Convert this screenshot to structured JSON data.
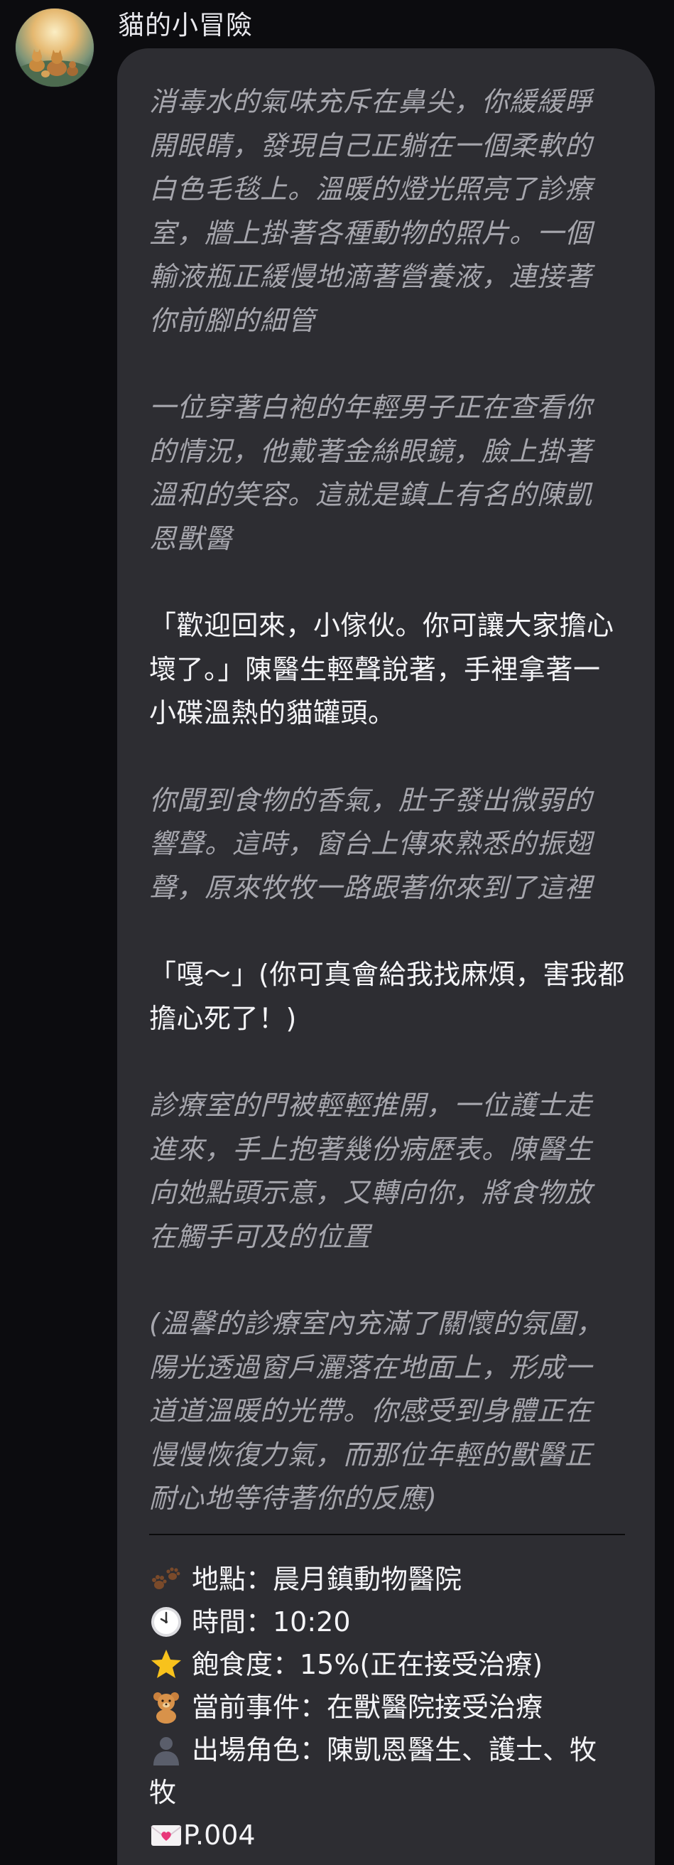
{
  "chat": {
    "sender_name": "貓的小冒險"
  },
  "message": {
    "p1": [
      "消毒水的氣味充斥在鼻尖，你緩緩睜",
      "開眼睛，發現自己正躺在一個柔軟的",
      "白色毛毯上。溫暖的燈光照亮了診療",
      "室，牆上掛著各種動物的照片。一個",
      "輸液瓶正緩慢地滴著營養液，連接著",
      "你前腳的細管"
    ],
    "p2": [
      "一位穿著白袍的年輕男子正在查看你",
      "的情況，他戴著金絲眼鏡，臉上掛著",
      "溫和的笑容。這就是鎮上有名的陳凱",
      "恩獸醫"
    ],
    "p3": [
      "「歡迎回來，小傢伙。你可讓大家擔心",
      "壞了。」陳醫生輕聲說著，手裡拿著一",
      "小碟溫熱的貓罐頭。"
    ],
    "p4": [
      "你聞到食物的香氣，肚子發出微弱的",
      "響聲。這時，窗台上傳來熟悉的振翅",
      "聲，原來牧牧一路跟著你來到了這裡"
    ],
    "p5": [
      "「嘎～」(你可真會給我找麻煩，害我都",
      "擔心死了！)"
    ],
    "p6": [
      "診療室的門被輕輕推開，一位護士走",
      "進來，手上抱著幾份病歷表。陳醫生",
      "向她點頭示意，又轉向你，將食物放",
      "在觸手可及的位置"
    ],
    "p7": [
      "(溫馨的診療室內充滿了關懷的氛圍，",
      "陽光透過窗戶灑落在地面上，形成一",
      "道道溫暖的光帶。你感受到身體正在",
      "慢慢恢復力氣，而那位年輕的獸醫正",
      "耐心地等待著你的反應)"
    ]
  },
  "status": {
    "location": "地點：晨月鎮動物醫院",
    "time": "時間：10:20",
    "satiety": "飽食度：15%(正在接受治療)",
    "event": "當前事件：在獸醫院接受治療",
    "characters_line1": "出場角色：陳凱恩醫生、護士、牧",
    "characters_line2": "牧",
    "page": "P.004",
    "icons": {
      "location": "paw-prints-icon",
      "time": "clock-icon",
      "satiety": "star-icon",
      "event": "teddy-bear-icon",
      "characters": "person-silhouette-icon",
      "page": "love-letter-icon"
    }
  },
  "colors": {
    "background": "#0c0c0f",
    "bubble": "#2d2d32",
    "narration": "#a6a6ad",
    "dialogue": "#f4f4f7"
  }
}
